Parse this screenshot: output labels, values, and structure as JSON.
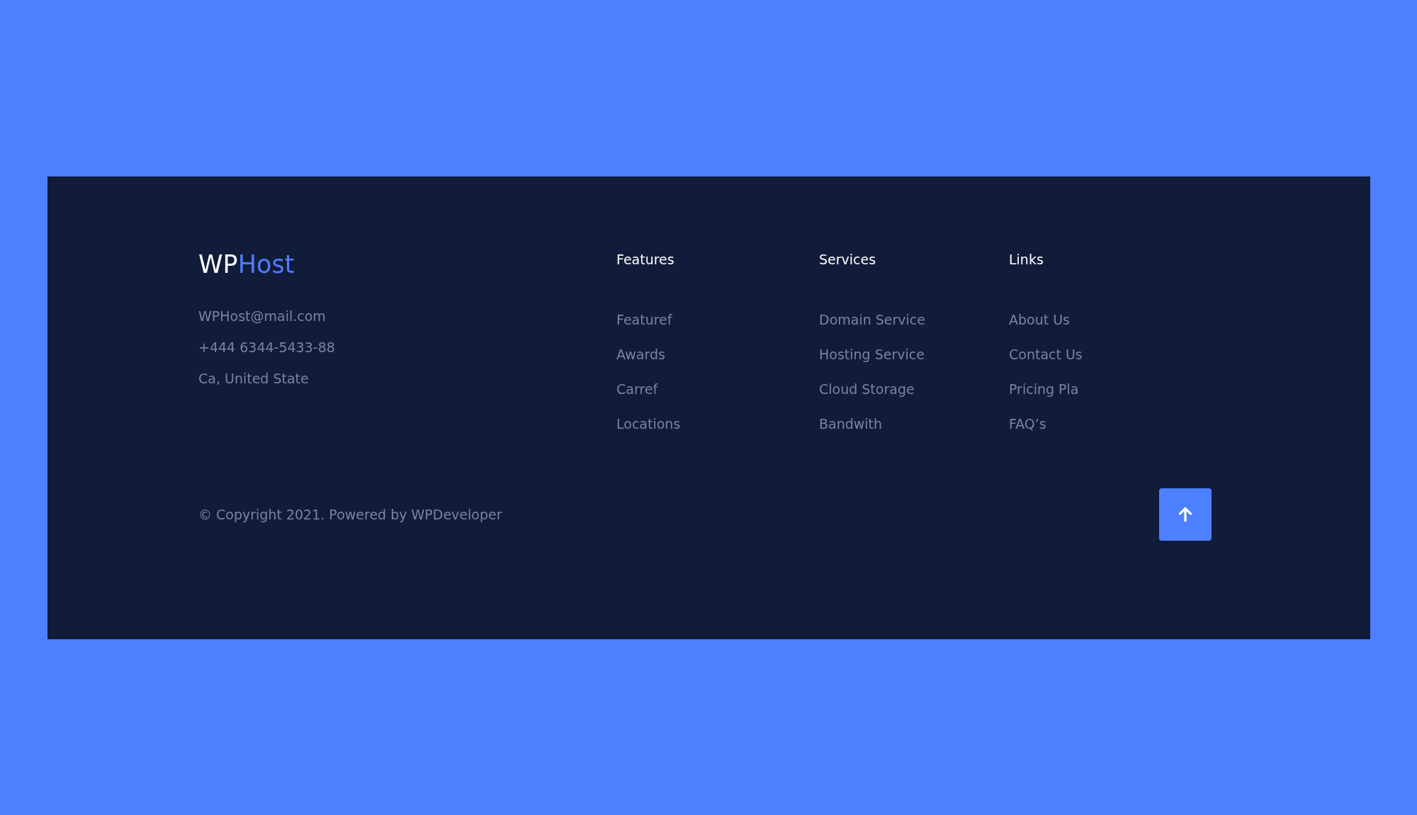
{
  "footer": {
    "logo": [
      {
        "text": "WP",
        "kind": "plain"
      },
      {
        "text": "Host",
        "kind": "accent"
      }
    ],
    "contact": [
      "WPHost@mail.com",
      "+444 6344-5433-88",
      "Ca, United State"
    ],
    "columns": [
      {
        "heading": "Features",
        "links": [
          "Featuref",
          "Awards",
          "Carref",
          "Locations"
        ]
      },
      {
        "heading": "Services",
        "links": [
          "Domain Service",
          "Hosting Service",
          "Cloud Storage",
          "Bandwith"
        ]
      },
      {
        "heading": "Links",
        "links": [
          "About Us",
          "Contact Us",
          "Pricing Pla",
          "FAQ’s"
        ]
      }
    ],
    "copyright": "© Copyright 2021. Powered by WPDeveloper"
  }
}
